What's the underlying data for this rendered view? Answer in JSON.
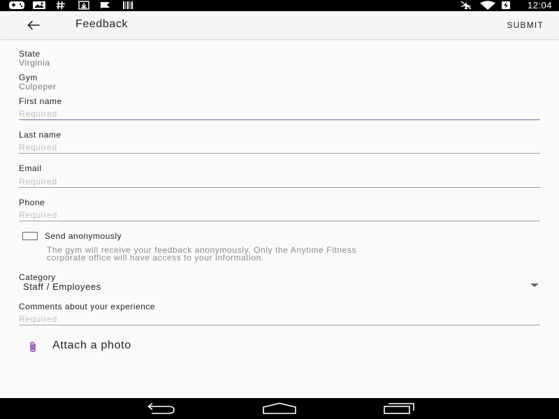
{
  "status_bar": {
    "time": "12:04",
    "icons_left": [
      "game-controller-icon",
      "image-icon",
      "hashtag-icon",
      "download-icon",
      "flag-icon",
      "barcode-icon"
    ],
    "icons_right": [
      "airplane-mode-off-icon",
      "wifi-icon",
      "battery-charging-icon"
    ]
  },
  "app_bar": {
    "back_icon": "arrow-back-icon",
    "title": "Feedback",
    "submit_label": "SUBMIT"
  },
  "form": {
    "state": {
      "label": "State",
      "value": "Virginia"
    },
    "gym": {
      "label": "Gym",
      "value": "Culpeper"
    },
    "first_name": {
      "label": "First name",
      "placeholder": "Required"
    },
    "last_name": {
      "label": "Last name",
      "placeholder": "Required"
    },
    "email": {
      "label": "Email",
      "placeholder": "Required"
    },
    "phone": {
      "label": "Phone",
      "placeholder": "Required"
    },
    "anonymous": {
      "label": "Send anonymously",
      "checked": false,
      "note_line1": "The gym will receive your feedback anonymously. Only the Anytime Fitness",
      "note_line2": "corporate office will have access to your information."
    },
    "category": {
      "label": "Category",
      "value": "Staff / Employees"
    },
    "comments": {
      "label": "Comments about your experience",
      "placeholder": "Required"
    },
    "attach": {
      "icon": "paperclip-icon",
      "label": "Attach a photo"
    }
  },
  "nav_bar": {
    "items": [
      "back-nav-icon",
      "home-nav-icon",
      "recents-nav-icon"
    ]
  },
  "colors": {
    "accent": "#7e6f9e",
    "paperclip": "#8e44ad",
    "placeholder": "#bdbdbd",
    "divider": "#9e9e9e"
  }
}
